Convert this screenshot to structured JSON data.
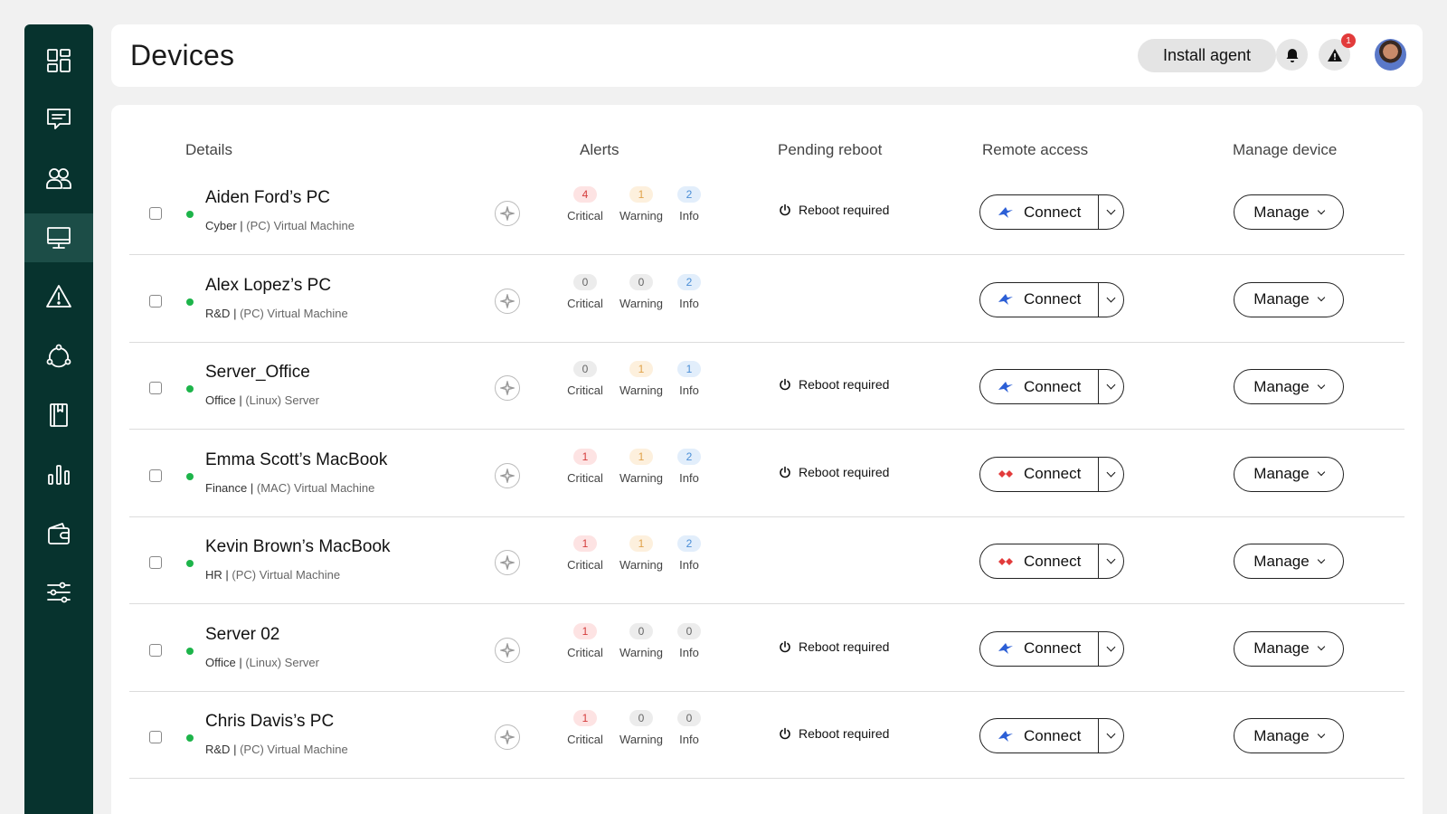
{
  "header": {
    "title": "Devices",
    "install_label": "Install agent",
    "alert_badge": "1"
  },
  "sidebar": {
    "items": [
      {
        "icon": "dashboard-icon"
      },
      {
        "icon": "chat-icon"
      },
      {
        "icon": "users-icon"
      },
      {
        "icon": "monitor-icon",
        "active": true
      },
      {
        "icon": "warning-icon"
      },
      {
        "icon": "network-icon"
      },
      {
        "icon": "book-icon"
      },
      {
        "icon": "bar-chart-icon"
      },
      {
        "icon": "wallet-icon"
      },
      {
        "icon": "sliders-icon"
      }
    ]
  },
  "table": {
    "columns": {
      "details": "Details",
      "alerts": "Alerts",
      "reboot": "Pending reboot",
      "remote": "Remote access",
      "manage": "Manage device"
    },
    "alert_labels": {
      "critical": "Critical",
      "warning": "Warning",
      "info": "Info"
    },
    "connect_label": "Connect",
    "manage_label": "Manage",
    "reboot_label": "Reboot required",
    "rows": [
      {
        "name": "Aiden Ford’s PC",
        "group": "Cyber",
        "type": "(PC) Virtual Machine",
        "critical": "4",
        "warning": "1",
        "info": "2",
        "reboot": true,
        "connect_brand": "blue"
      },
      {
        "name": "Alex Lopez’s PC",
        "group": "R&D",
        "type": "(PC) Virtual Machine",
        "critical": "0",
        "warning": "0",
        "info": "2",
        "reboot": false,
        "connect_brand": "blue"
      },
      {
        "name": "Server_Office",
        "group": "Office",
        "type": "(Linux) Server",
        "critical": "0",
        "warning": "1",
        "info": "1",
        "reboot": true,
        "connect_brand": "blue"
      },
      {
        "name": "Emma Scott’s MacBook",
        "group": "Finance",
        "type": "(MAC) Virtual Machine",
        "critical": "1",
        "warning": "1",
        "info": "2",
        "reboot": true,
        "connect_brand": "red"
      },
      {
        "name": "Kevin Brown’s MacBook",
        "group": "HR",
        "type": "(PC) Virtual Machine",
        "critical": "1",
        "warning": "1",
        "info": "2",
        "reboot": false,
        "connect_brand": "red"
      },
      {
        "name": "Server 02",
        "group": "Office",
        "type": "(Linux) Server",
        "critical": "1",
        "warning": "0",
        "info": "0",
        "reboot": true,
        "connect_brand": "blue"
      },
      {
        "name": "Chris Davis’s PC",
        "group": "R&D",
        "type": "(PC) Virtual Machine",
        "critical": "1",
        "warning": "0",
        "info": "0",
        "reboot": true,
        "connect_brand": "blue"
      }
    ]
  },
  "colors": {
    "sidebar": "#07332e",
    "status_online": "#1db44a",
    "brand_blue": "#2c5fd6",
    "brand_red": "#e23b3b"
  }
}
